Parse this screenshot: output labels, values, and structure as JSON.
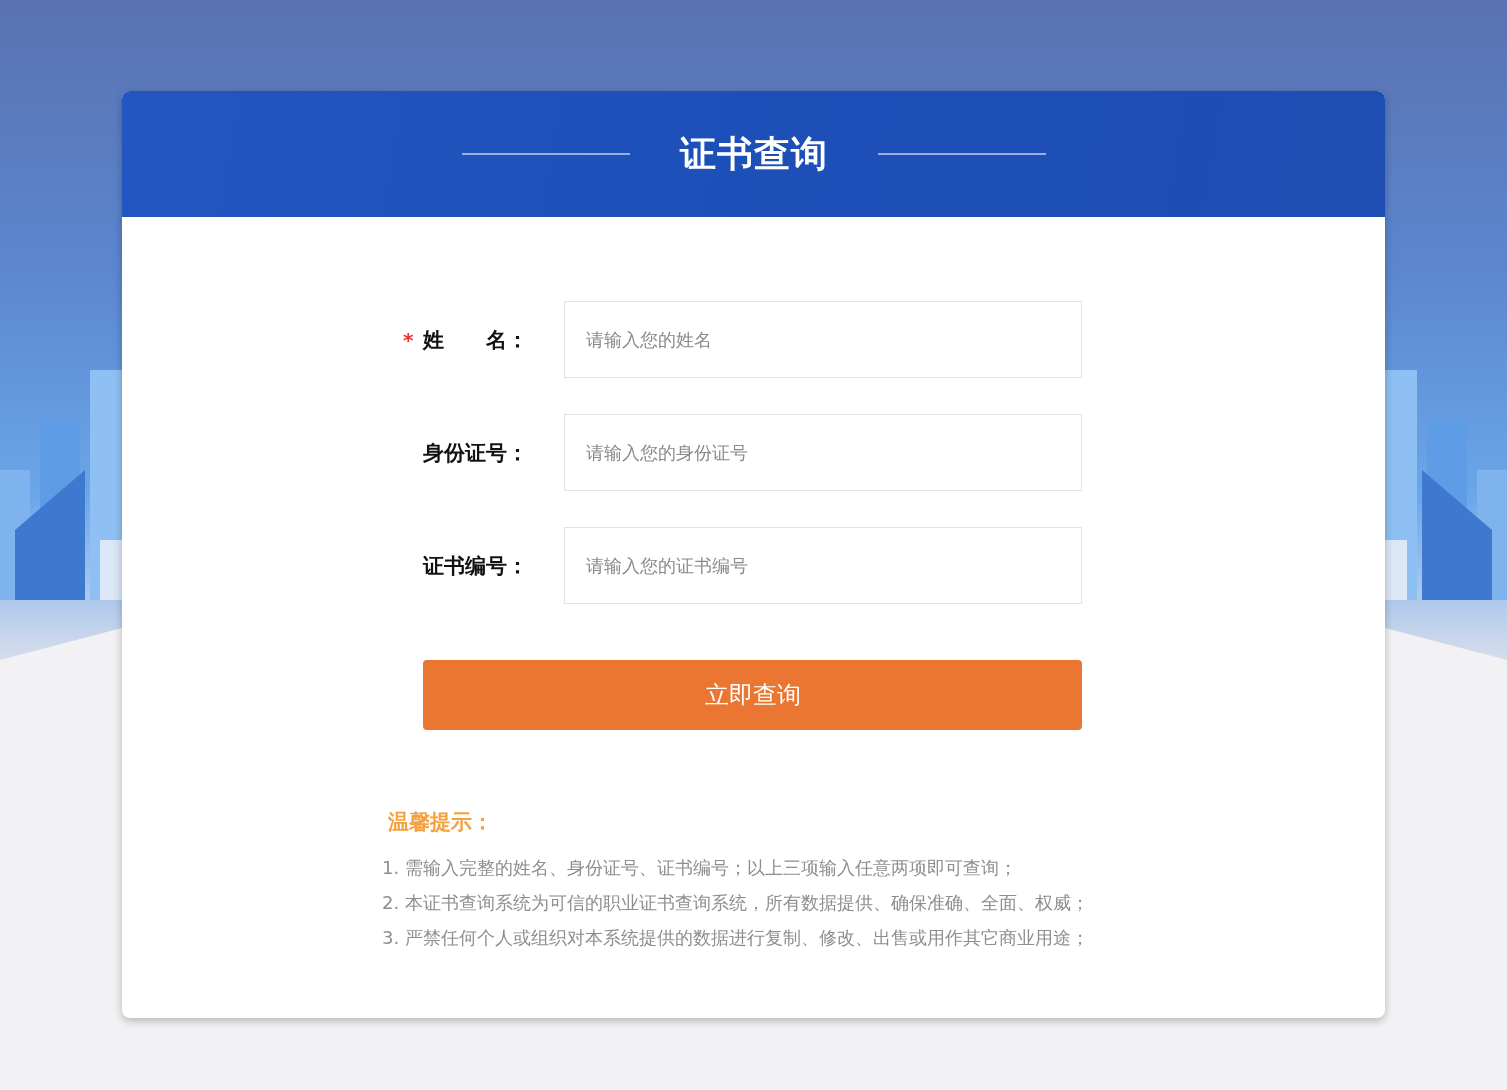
{
  "header": {
    "title": "证书查询"
  },
  "form": {
    "fields": [
      {
        "label": "姓　　名：",
        "required": true,
        "placeholder": "请输入您的姓名"
      },
      {
        "label": "身份证号：",
        "required": false,
        "placeholder": "请输入您的身份证号"
      },
      {
        "label": "证书编号：",
        "required": false,
        "placeholder": "请输入您的证书编号"
      }
    ],
    "required_mark": "*",
    "submit": "立即查询"
  },
  "tips": {
    "title": "温馨提示：",
    "items": [
      "1. 需输入完整的姓名、身份证号、证书编号；以上三项输入任意两项即可查询；",
      "2. 本证书查询系统为可信的职业证书查询系统，所有数据提供、确保准确、全面、权威；",
      "3. 严禁任何个人或组织对本系统提供的数据进行复制、修改、出售或用作其它商业用途；"
    ]
  }
}
